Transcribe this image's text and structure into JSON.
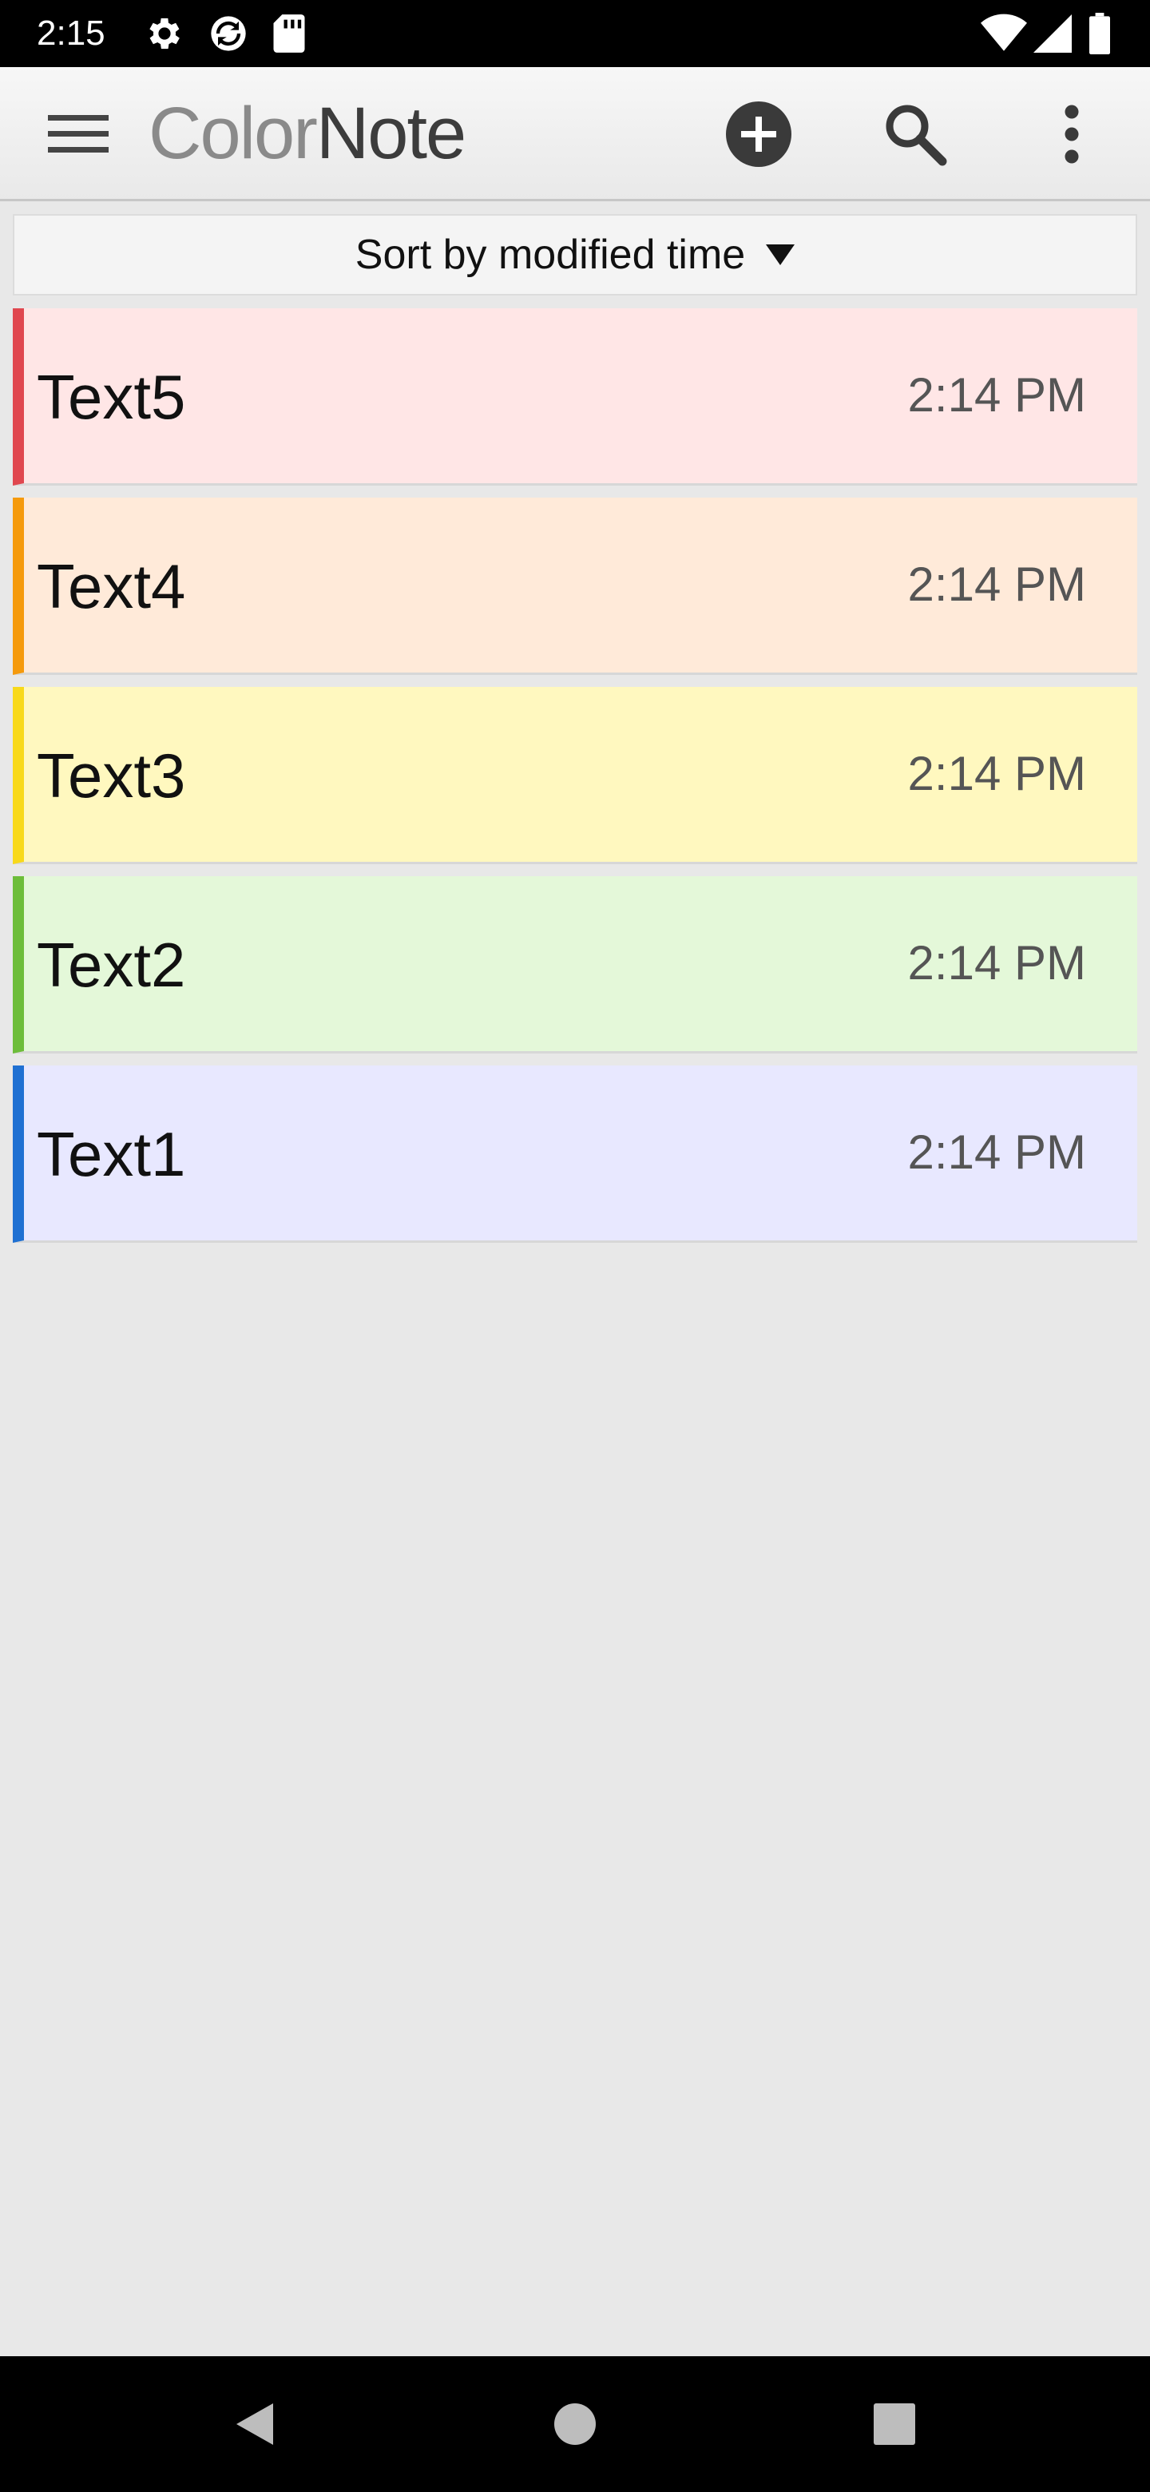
{
  "status_bar": {
    "time": "2:15",
    "icons": [
      "settings-icon",
      "sync-icon",
      "sd-card-icon",
      "wifi-icon",
      "signal-icon",
      "battery-icon"
    ]
  },
  "app_bar": {
    "title_color": "Color",
    "title_note": "Note",
    "icons": [
      "menu-icon",
      "add-icon",
      "search-icon",
      "more-vert-icon"
    ]
  },
  "sort_bar": {
    "label": "Sort by modified time"
  },
  "notes": [
    {
      "title": "Text5",
      "time": "2:14 PM",
      "bg": "#ffe6e6",
      "accent": "#e0474f"
    },
    {
      "title": "Text4",
      "time": "2:14 PM",
      "bg": "#ffead9",
      "accent": "#f59a0c"
    },
    {
      "title": "Text3",
      "time": "2:14 PM",
      "bg": "#fff8bf",
      "accent": "#f8d91a"
    },
    {
      "title": "Text2",
      "time": "2:14 PM",
      "bg": "#e4f8d9",
      "accent": "#6dbd3a"
    },
    {
      "title": "Text1",
      "time": "2:14 PM",
      "bg": "#e8e8ff",
      "accent": "#1f70d2"
    }
  ],
  "nav_bar": {
    "icons": [
      "back-icon",
      "home-icon",
      "recents-icon"
    ]
  },
  "colors": {
    "background": "#e8e8e8",
    "status_bar": "#000000",
    "nav_bar": "#000000"
  }
}
